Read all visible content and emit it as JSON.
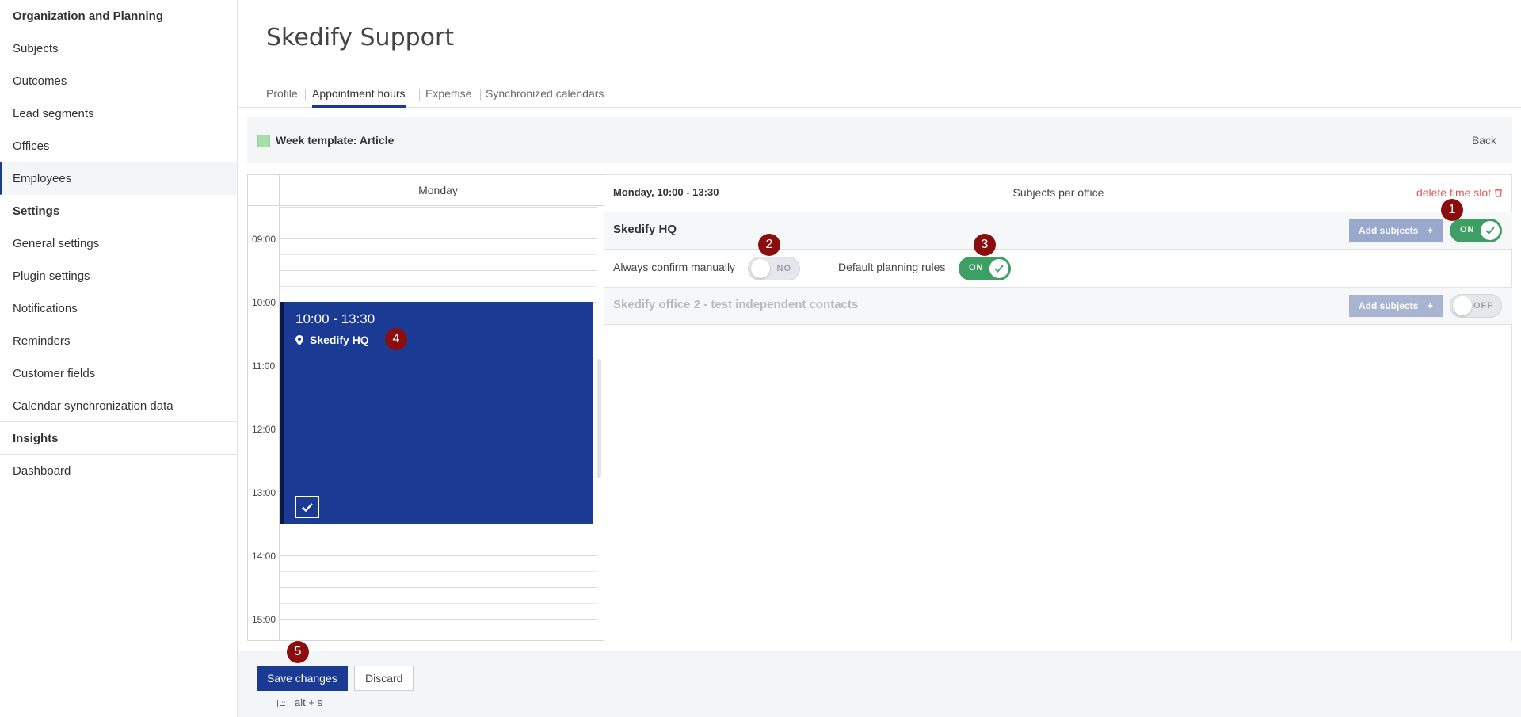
{
  "sidebar": {
    "items": [
      {
        "label": "Organization and Planning"
      },
      {
        "label": "Subjects"
      },
      {
        "label": "Outcomes"
      },
      {
        "label": "Lead segments"
      },
      {
        "label": "Offices"
      },
      {
        "label": "Employees"
      },
      {
        "label": "Settings"
      },
      {
        "label": "General settings"
      },
      {
        "label": "Plugin settings"
      },
      {
        "label": "Notifications"
      },
      {
        "label": "Reminders"
      },
      {
        "label": "Customer fields"
      },
      {
        "label": "Calendar synchronization data"
      },
      {
        "label": "Insights"
      },
      {
        "label": "Dashboard"
      }
    ]
  },
  "page": {
    "title": "Skedify Support"
  },
  "tabs": [
    {
      "label": "Profile"
    },
    {
      "label": "Appointment hours"
    },
    {
      "label": "Expertise"
    },
    {
      "label": "Synchronized calendars"
    }
  ],
  "week_template": {
    "label": "Week template: Article",
    "back": "Back",
    "color": "#a4e0a8"
  },
  "calendar": {
    "day": "Monday",
    "hours": [
      "09:00",
      "10:00",
      "11:00",
      "12:00",
      "13:00",
      "14:00",
      "15:00"
    ],
    "event": {
      "time": "10:00 - 13:30",
      "location": "Skedify HQ",
      "color": "#1a3a94"
    }
  },
  "detail": {
    "title": "Monday, 10:00 - 13:30",
    "subtitle": "Subjects per office",
    "delete": "delete time slot",
    "offices": [
      {
        "name": "Skedify HQ",
        "add_label": "Add subjects",
        "toggle": "ON"
      },
      {
        "name": "Skedify office 2 - test independent contacts",
        "add_label": "Add subjects",
        "toggle": "OFF"
      }
    ],
    "options": {
      "confirm_label": "Always confirm manually",
      "confirm_toggle": "NO",
      "rules_label": "Default planning rules",
      "rules_toggle": "ON"
    }
  },
  "markers": [
    "1",
    "2",
    "3",
    "4",
    "5"
  ],
  "footer": {
    "save": "Save changes",
    "discard": "Discard",
    "shortcut": "alt + s"
  },
  "colors": {
    "accent": "#1a3a94",
    "on": "#3e9f64",
    "marker": "#8b0d0d",
    "danger": "#e05a5a"
  }
}
